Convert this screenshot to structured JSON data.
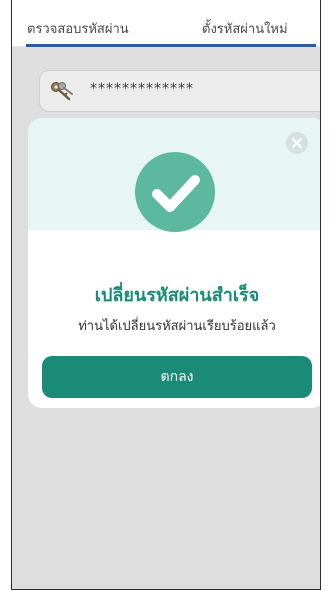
{
  "tabs": {
    "check_password": "ตรวจสอบรหัสผ่าน",
    "set_new_password": "ตั้งรหัสผ่านใหม่"
  },
  "password_field": {
    "masked_value": "*************",
    "icon": "key-icon"
  },
  "dialog": {
    "close_icon": "close-icon",
    "status_icon": "check-circle-icon",
    "title": "เปลี่ยนรหัสผ่านสำเร็จ",
    "message": "ท่านได้เปลี่ยนรหัสผ่านเรียบร้อยแล้ว",
    "ok_label": "ตกลง"
  },
  "colors": {
    "accent": "#1a8b77",
    "tab_underline": "#2b5a9e",
    "check_circle": "#5cb99f"
  }
}
